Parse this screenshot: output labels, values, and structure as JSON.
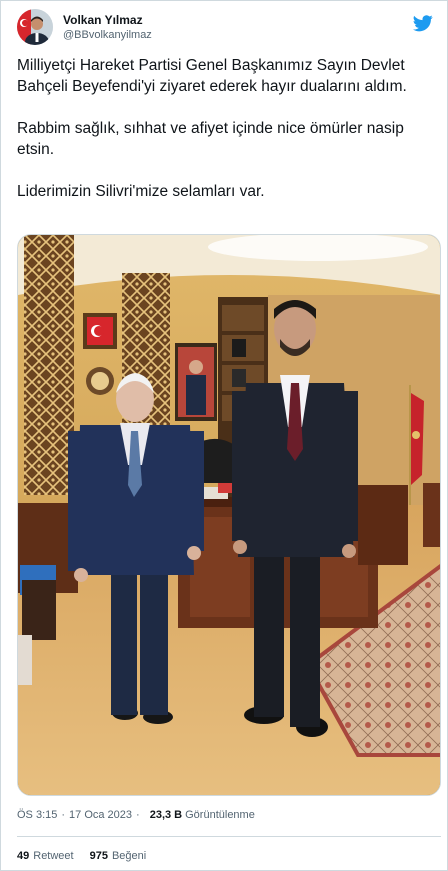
{
  "author": {
    "display_name": "Volkan Yılmaz",
    "handle": "@BBvolkanyilmaz"
  },
  "tweet": {
    "paragraphs": [
      "Milliyetçi Hareket Partisi Genel Başkanımız Sayın Devlet Bahçeli Beyefendi'yi ziyaret ederek hayır dualarını aldım.",
      "Rabbim sağlık, sıhhat ve afiyet içinde nice ömürler nasip etsin.",
      "Liderimizin Silivri'mize selamları var."
    ]
  },
  "meta": {
    "time": "ÖS 3:15",
    "date": "17 Oca 2023",
    "views_count": "23,3 B",
    "views_label": "Görüntülenme"
  },
  "stats": {
    "retweets_count": "49",
    "retweets_label": "Retweet",
    "likes_count": "975",
    "likes_label": "Beğeni"
  },
  "icons": {
    "brand": "twitter-bird-icon"
  },
  "colors": {
    "brand_blue": "#1d9bf0",
    "text_primary": "#0f1419",
    "text_secondary": "#536471",
    "border": "#cfd9de"
  }
}
